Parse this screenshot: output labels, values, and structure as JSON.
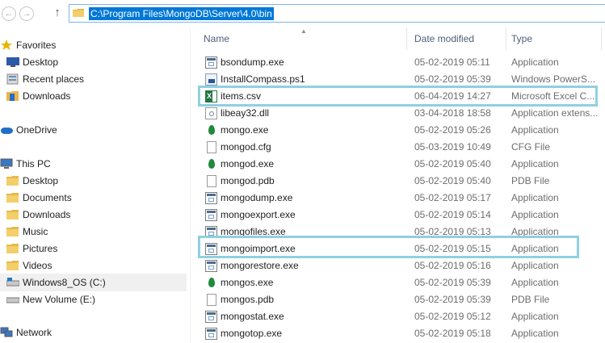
{
  "address": {
    "path": "C:\\Program Files\\MongoDB\\Server\\4.0\\bin"
  },
  "nav": [
    {
      "label": "Favorites",
      "icon": "star-icon"
    },
    {
      "label": "Desktop",
      "icon": "desktop-icon"
    },
    {
      "label": "Recent places",
      "icon": "recent-places-icon"
    },
    {
      "label": "Downloads",
      "icon": "downloads-folder-icon"
    },
    {
      "label": "OneDrive",
      "icon": "onedrive-cloud-icon"
    },
    {
      "label": "This PC",
      "icon": "computer-icon"
    },
    {
      "label": "Desktop",
      "icon": "folder-icon"
    },
    {
      "label": "Documents",
      "icon": "folder-icon"
    },
    {
      "label": "Downloads",
      "icon": "folder-icon"
    },
    {
      "label": "Music",
      "icon": "folder-icon"
    },
    {
      "label": "Pictures",
      "icon": "folder-icon"
    },
    {
      "label": "Videos",
      "icon": "folder-icon"
    },
    {
      "label": "Windows8_OS (C:)",
      "icon": "drive-icon"
    },
    {
      "label": "New Volume (E:)",
      "icon": "drive-icon"
    },
    {
      "label": "Network",
      "icon": "network-icon"
    }
  ],
  "columns": {
    "name": "Name",
    "date": "Date modified",
    "type": "Type"
  },
  "files": [
    {
      "name": "bsondump.exe",
      "date": "05-02-2019 05:11",
      "type": "Application",
      "icon": "exe"
    },
    {
      "name": "InstallCompass.ps1",
      "date": "05-02-2019 05:39",
      "type": "Windows PowerS...",
      "icon": "ps1"
    },
    {
      "name": "items.csv",
      "date": "06-04-2019 14:27",
      "type": "Microsoft Excel C...",
      "icon": "xls"
    },
    {
      "name": "libeay32.dll",
      "date": "03-04-2018 18:58",
      "type": "Application extens...",
      "icon": "dll"
    },
    {
      "name": "mongo.exe",
      "date": "05-02-2019 05:26",
      "type": "Application",
      "icon": "leaf"
    },
    {
      "name": "mongod.cfg",
      "date": "05-03-2019 10:49",
      "type": "CFG File",
      "icon": "doc"
    },
    {
      "name": "mongod.exe",
      "date": "05-02-2019 05:40",
      "type": "Application",
      "icon": "leaf"
    },
    {
      "name": "mongod.pdb",
      "date": "05-02-2019 05:40",
      "type": "PDB File",
      "icon": "doc"
    },
    {
      "name": "mongodump.exe",
      "date": "05-02-2019 05:17",
      "type": "Application",
      "icon": "exe"
    },
    {
      "name": "mongoexport.exe",
      "date": "05-02-2019 05:14",
      "type": "Application",
      "icon": "exe"
    },
    {
      "name": "mongofiles.exe",
      "date": "05-02-2019 05:13",
      "type": "Application",
      "icon": "exe"
    },
    {
      "name": "mongoimport.exe",
      "date": "05-02-2019 05:15",
      "type": "Application",
      "icon": "exe"
    },
    {
      "name": "mongorestore.exe",
      "date": "05-02-2019 05:16",
      "type": "Application",
      "icon": "exe"
    },
    {
      "name": "mongos.exe",
      "date": "05-02-2019 05:39",
      "type": "Application",
      "icon": "leaf"
    },
    {
      "name": "mongos.pdb",
      "date": "05-02-2019 05:39",
      "type": "PDB File",
      "icon": "doc"
    },
    {
      "name": "mongostat.exe",
      "date": "05-02-2019 05:12",
      "type": "Application",
      "icon": "exe"
    },
    {
      "name": "mongotop.exe",
      "date": "05-02-2019 05:18",
      "type": "Application",
      "icon": "exe"
    }
  ],
  "colors": {
    "highlight": "#8fd0e0",
    "selection": "#0078d7",
    "header_text": "#4c607a"
  }
}
